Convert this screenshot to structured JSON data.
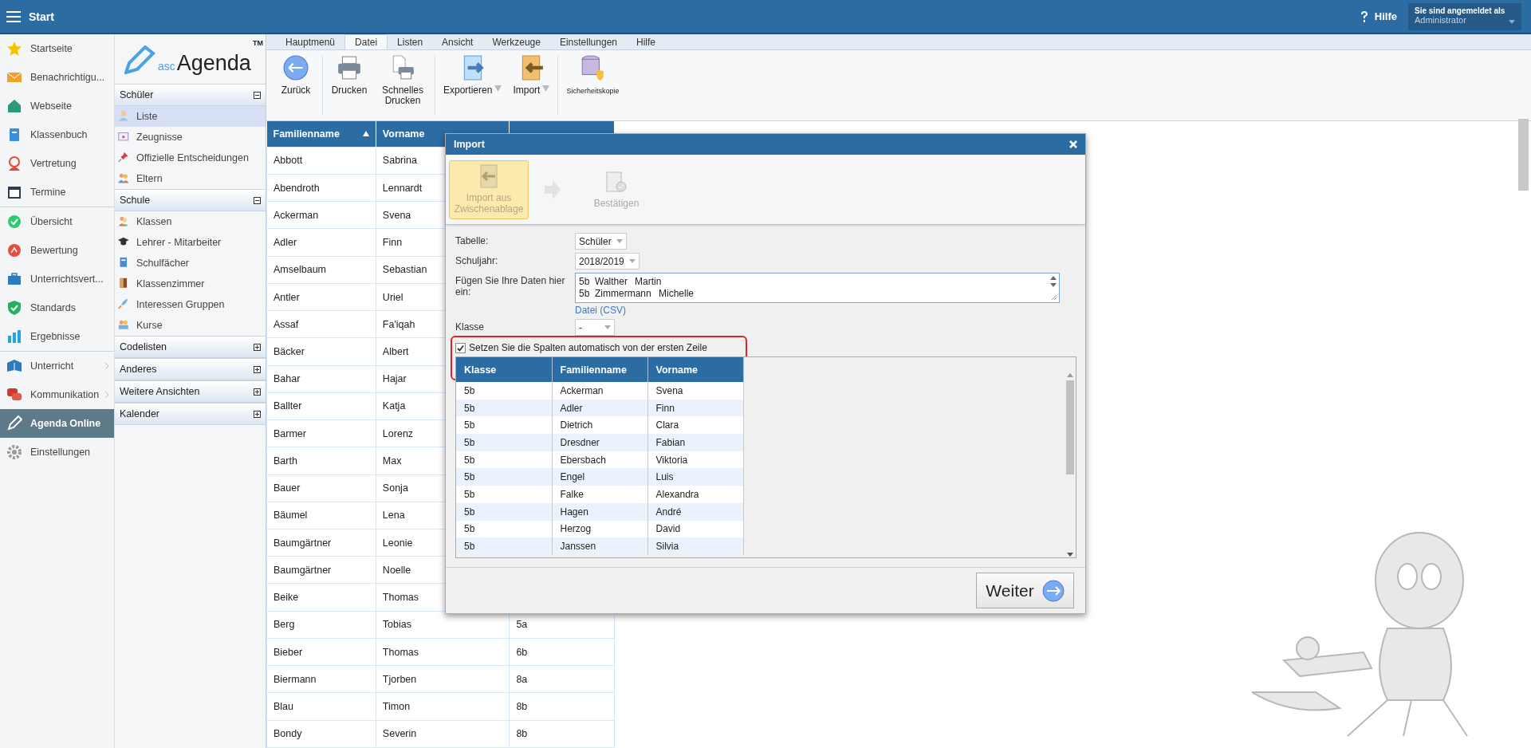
{
  "header": {
    "title": "Start",
    "help": "Hilfe",
    "user_label": "Sie sind angemeldet als",
    "user": "Administrator"
  },
  "nav_groups": [
    [
      {
        "label": "Startseite",
        "selected": false,
        "submenu": false
      },
      {
        "label": "Benachrichtigu...",
        "selected": false,
        "submenu": false
      },
      {
        "label": "Webseite",
        "selected": false,
        "submenu": false
      },
      {
        "label": "Klassenbuch",
        "selected": false,
        "submenu": false
      },
      {
        "label": "Vertretung",
        "selected": false,
        "submenu": false
      },
      {
        "label": "Termine",
        "selected": false,
        "submenu": false
      }
    ],
    [
      {
        "label": "Übersicht",
        "selected": false,
        "submenu": false
      },
      {
        "label": "Bewertung",
        "selected": false,
        "submenu": false
      },
      {
        "label": "Unterrichtsvert...",
        "selected": false,
        "submenu": false
      },
      {
        "label": "Standards",
        "selected": false,
        "submenu": false
      },
      {
        "label": "Ergebnisse",
        "selected": false,
        "submenu": false
      }
    ],
    [
      {
        "label": "Unterricht",
        "selected": false,
        "submenu": true
      },
      {
        "label": "Kommunikation",
        "selected": false,
        "submenu": true
      },
      {
        "label": "Agenda Online",
        "selected": true,
        "submenu": false
      },
      {
        "label": "Einstellungen",
        "selected": false,
        "submenu": false
      }
    ]
  ],
  "logo": {
    "prefix": "asc",
    "name": "Agenda",
    "mark": "TM"
  },
  "sections": [
    {
      "title": "Schüler",
      "expanded": true,
      "items": [
        {
          "label": "Liste",
          "selected": true
        },
        {
          "label": "Zeugnisse",
          "selected": false
        },
        {
          "label": "Offizielle Entscheidungen",
          "selected": false
        },
        {
          "label": "Eltern",
          "selected": false
        }
      ]
    },
    {
      "title": "Schule",
      "expanded": true,
      "items": [
        {
          "label": "Klassen",
          "selected": false
        },
        {
          "label": "Lehrer - Mitarbeiter",
          "selected": false
        },
        {
          "label": "Schulfächer",
          "selected": false
        },
        {
          "label": "Klassenzimmer",
          "selected": false
        },
        {
          "label": "Interessen Gruppen",
          "selected": false
        },
        {
          "label": "Kurse",
          "selected": false
        }
      ]
    },
    {
      "title": "Codelisten",
      "expanded": false
    },
    {
      "title": "Anderes",
      "expanded": false
    },
    {
      "title": "Weitere Ansichten",
      "expanded": false
    },
    {
      "title": "Kalender",
      "expanded": false
    }
  ],
  "ribbon": {
    "tabs": [
      {
        "label": "Hauptmenü",
        "selected": false
      },
      {
        "label": "Datei",
        "selected": true
      },
      {
        "label": "Listen",
        "selected": false
      },
      {
        "label": "Ansicht",
        "selected": false
      },
      {
        "label": "Werkzeuge",
        "selected": false
      },
      {
        "label": "Einstellungen",
        "selected": false
      },
      {
        "label": "Hilfe",
        "selected": false
      }
    ],
    "groups": [
      [
        {
          "label": "Zurück",
          "dropdown": false
        }
      ],
      [
        {
          "label": "Drucken",
          "dropdown": false
        },
        {
          "label": "Schnelles Drucken",
          "dropdown": false
        }
      ],
      [
        {
          "label": "Exportieren",
          "dropdown": true
        },
        {
          "label": "Import",
          "dropdown": true
        }
      ],
      [
        {
          "label": "Sicherheitskopie",
          "dropdown": false
        }
      ]
    ]
  },
  "students": {
    "columns": [
      "Familienname",
      "Vorname"
    ],
    "rows": [
      {
        "last": "Abbott",
        "first": "Sabrina"
      },
      {
        "last": "Abendroth",
        "first": "Lennardt"
      },
      {
        "last": "Ackerman",
        "first": "Svena"
      },
      {
        "last": "Adler",
        "first": "Finn"
      },
      {
        "last": "Amselbaum",
        "first": "Sebastian"
      },
      {
        "last": "Antler",
        "first": "Uriel"
      },
      {
        "last": "Assaf",
        "first": "Fa'iqah"
      },
      {
        "last": "Bäcker",
        "first": "Albert"
      },
      {
        "last": "Bahar",
        "first": "Hajar"
      },
      {
        "last": "Ballter",
        "first": "Katja"
      },
      {
        "last": "Barmer",
        "first": "Lorenz"
      },
      {
        "last": "Barth",
        "first": "Max"
      },
      {
        "last": "Bauer",
        "first": "Sonja"
      },
      {
        "last": "Bäumel",
        "first": "Lena"
      },
      {
        "last": "Baumgärtner",
        "first": "Leonie"
      },
      {
        "last": "Baumgärtner",
        "first": "Noelle"
      },
      {
        "last": "Beike",
        "first": "Thomas"
      },
      {
        "last": "Berg",
        "first": "Tobias",
        "class": "5a"
      },
      {
        "last": "Bieber",
        "first": "Thomas",
        "class": "6b"
      },
      {
        "last": "Biermann",
        "first": "Tjorben",
        "class": "8a"
      },
      {
        "last": "Blau",
        "first": "Timon",
        "class": "8b"
      },
      {
        "last": "Bondy",
        "first": "Severin",
        "class": "8b"
      }
    ]
  },
  "dialog": {
    "title": "Import",
    "steps": [
      {
        "label": "Import aus Zwischenablage",
        "selected": true
      },
      {
        "label": "Bestätigen",
        "selected": false
      }
    ],
    "table_label": "Tabelle:",
    "table_value": "Schüler",
    "year_label": "Schuljahr:",
    "year_value": "2018/2019",
    "paste_label": "Fügen Sie Ihre Daten hier ein:",
    "paste_lines": [
      "5b\tWalther\tMartin",
      "5b\tZimmermann\tMichelle"
    ],
    "file_link": "Datei (CSV)",
    "class_label": "Klasse",
    "class_value": "-",
    "auto_columns": {
      "label": "Setzen Sie die Spalten automatisch von der ersten Zeile",
      "checked": true
    },
    "preview": {
      "columns": [
        "Klasse",
        "Familienname",
        "Vorname"
      ],
      "rows": [
        [
          "5b",
          "Ackerman",
          "Svena"
        ],
        [
          "5b",
          "Adler",
          "Finn"
        ],
        [
          "5b",
          "Dietrich",
          "Clara"
        ],
        [
          "5b",
          "Dresdner",
          "Fabian"
        ],
        [
          "5b",
          "Ebersbach",
          "Viktoria"
        ],
        [
          "5b",
          "Engel",
          "Luis"
        ],
        [
          "5b",
          "Falke",
          "Alexandra"
        ],
        [
          "5b",
          "Hagen",
          "André"
        ],
        [
          "5b",
          "Herzog",
          "David"
        ],
        [
          "5b",
          "Janssen",
          "Silvia"
        ]
      ]
    },
    "next_button": "Weiter"
  }
}
